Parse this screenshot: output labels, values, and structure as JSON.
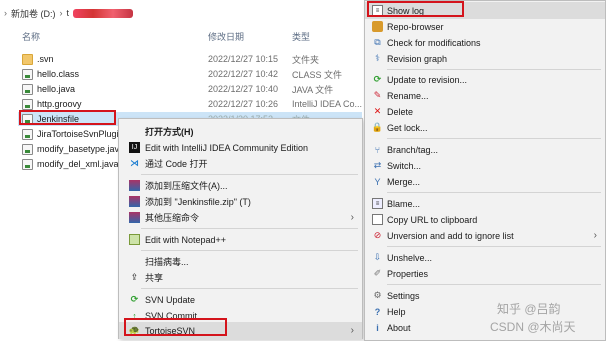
{
  "address": {
    "drive": "新加卷 (D:)",
    "folder": "t"
  },
  "columns": {
    "name": "名称",
    "date": "修改日期",
    "type": "类型"
  },
  "files": [
    {
      "name": ".svn",
      "date": "2022/12/27 10:15",
      "type": "文件夹",
      "icon": "folder"
    },
    {
      "name": "hello.class",
      "date": "2022/12/27 10:42",
      "type": "CLASS 文件",
      "icon": "file"
    },
    {
      "name": "hello.java",
      "date": "2022/12/27 10:40",
      "type": "JAVA 文件",
      "icon": "java"
    },
    {
      "name": "http.groovy",
      "date": "2022/12/27 10:26",
      "type": "IntelliJ IDEA Co...",
      "icon": "java"
    },
    {
      "name": "Jenkinsfile",
      "date": "2023/1/30 17:52",
      "type": "文件",
      "icon": "java"
    },
    {
      "name": "JiraTortoiseSvnPlugi",
      "date": "",
      "type": "",
      "icon": "java"
    },
    {
      "name": "modify_basetype.jav",
      "date": "",
      "type": "",
      "icon": "java"
    },
    {
      "name": "modify_del_xml.java",
      "date": "",
      "type": "",
      "icon": "java"
    }
  ],
  "context_menu": {
    "open_with": "打开方式(H)",
    "edit_intellij": "Edit with IntelliJ IDEA Community Edition",
    "open_vscode": "通过 Code 打开",
    "add_archive": "添加到压缩文件(A)...",
    "add_zip": "添加到 \"Jenkinsfile.zip\" (T)",
    "other_compress": "其他压缩命令",
    "edit_notepad": "Edit with Notepad++",
    "scan_virus": "扫描病毒...",
    "share": "共享",
    "svn_update": "SVN Update",
    "svn_commit": "SVN Commit...",
    "tortoise": "TortoiseSVN"
  },
  "svn_menu": {
    "show_log": "Show log",
    "repo_browser": "Repo-browser",
    "check_mods": "Check for modifications",
    "revision_graph": "Revision graph",
    "update_rev": "Update to revision...",
    "rename": "Rename...",
    "delete": "Delete",
    "get_lock": "Get lock...",
    "branch_tag": "Branch/tag...",
    "switch": "Switch...",
    "merge": "Merge...",
    "blame": "Blame...",
    "copy_url": "Copy URL to clipboard",
    "unversion": "Unversion and add to ignore list",
    "unshelve": "Unshelve...",
    "properties": "Properties",
    "settings": "Settings",
    "help": "Help",
    "about": "About"
  },
  "watermark": {
    "line1": "知乎 @吕韵",
    "line2": "CSDN @木尚天"
  }
}
